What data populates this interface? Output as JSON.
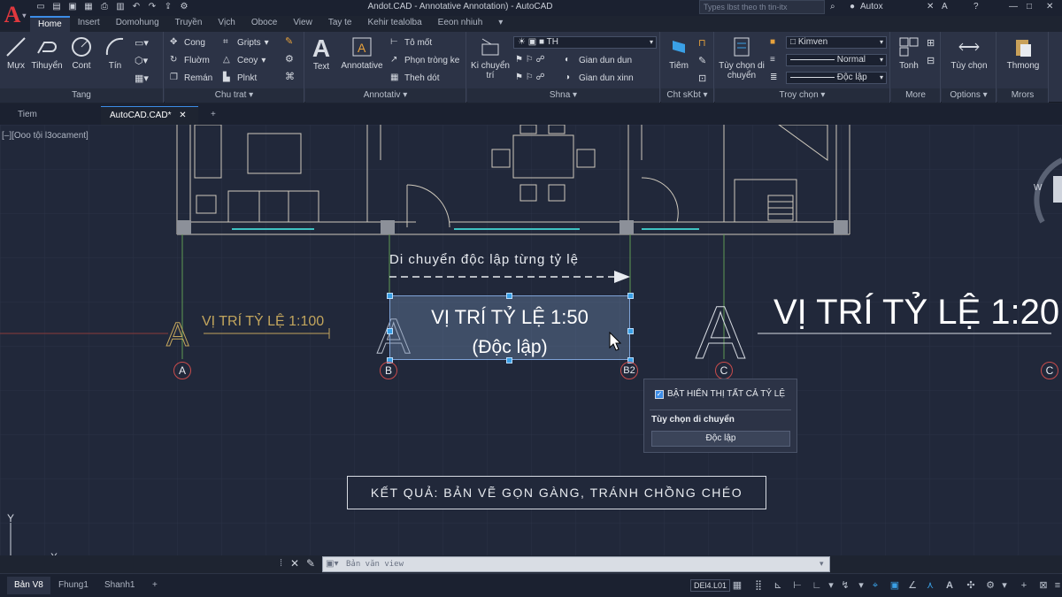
{
  "app": {
    "logo": "A",
    "window_title": "Andot.CAD - Annotative Annotation) - AutoCAD",
    "search_placeholder": "Types lbst theo th tin-itx",
    "user": "Autox"
  },
  "ribbon_tabs": [
    "Home",
    "Insert",
    "Domohung",
    "Truyền",
    "Vịch",
    "Oboce",
    "View",
    "Tay te",
    "Kehir tealolba",
    "Eeon nhiuh"
  ],
  "ribbon": {
    "draw": {
      "title": "Tang",
      "big": [
        "Mựx",
        "Tihuyển",
        "Cont",
        "Tín"
      ]
    },
    "modify": {
      "title": "Chu trat",
      "items": [
        "Cong",
        "Fluờm",
        "Remán",
        "Gripts",
        "Ceoy",
        "Plnkt"
      ]
    },
    "annotation": {
      "title": "Annotativ",
      "big": [
        "Text",
        "Annotative"
      ],
      "items": [
        "Tô mốt",
        "Phọn tròng ke",
        "Theh dót"
      ]
    },
    "layers": {
      "title": "Shna",
      "big": "Ki chuyển trí",
      "layer_value": "TH",
      "items": [
        "Gian dun dun",
        "Gian dun xinn"
      ]
    },
    "block": {
      "title": "Cht sKbt",
      "big": "Tiêm"
    },
    "properties": {
      "title": "Troy chọn",
      "big": "Tùy chọn di chuyển",
      "color_value": "Kimven",
      "linetype_value": "Normal",
      "lineweight_value": "Độc lập"
    },
    "groups": {
      "title": "More",
      "big": "Tonh"
    },
    "utilities": {
      "title": "Options",
      "big": "Tùy chọn"
    },
    "clipboard": {
      "title": "Mrors",
      "big": "Thmong"
    }
  },
  "doc_tabs": [
    "Tiem",
    "AutoCAD.CAD*"
  ],
  "viewport_label": "[–][Ooo tội l3ocament]",
  "drawing": {
    "move_label": "Di chuyển độc lập từng tỷ lệ",
    "label_100": "VỊ TRÍ TỶ LỆ 1:100",
    "label_50": "VỊ TRÍ TỶ LỆ 1:50",
    "label_50_sub": "(Độc lập)",
    "label_20": "VỊ TRÍ TỶ LỆ 1:20",
    "bubbles": [
      "A",
      "B",
      "B2",
      "C",
      "C"
    ],
    "big_a": "A",
    "result": "KẾT QUẢ: BẢN VẼ GỌN GÀNG, TRÁNH CHỒNG CHÉO",
    "viewcube_w": "W",
    "ucs_y": "Y",
    "ucs_x": "X"
  },
  "popup": {
    "checkbox_label": "BẬT HIỂN THỊ TẤT CẢ TỶ LỆ",
    "checked": true,
    "section_title": "Tùy chọn di chuyển",
    "button_label": "Độc lập"
  },
  "command_line": {
    "placeholder": "Bản văn view"
  },
  "status_bar": {
    "layout_tabs": [
      "Bản V8",
      "Fhung1",
      "Shanh1"
    ],
    "coordinate": "DEl4.L01"
  },
  "colors": {
    "accent": "#3c8ce7",
    "grip": "#3aa0e6",
    "axis_bubble": "#c94c4c",
    "annotation_gold": "#c2a55d",
    "background": "#21283a"
  }
}
